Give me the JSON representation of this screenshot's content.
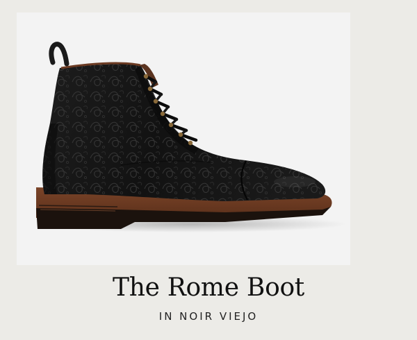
{
  "product": {
    "title": "The Rome Boot",
    "subtitle": "IN NOIR VIEJO",
    "image_alt": "Black embossed leather cap-toe lace-up boot with brown welt sole"
  },
  "colors": {
    "page_background": "#ecebe7",
    "photo_background": "#f3f3f3",
    "leather": "#141414",
    "welt": "#6b3a22",
    "text": "#111111"
  }
}
